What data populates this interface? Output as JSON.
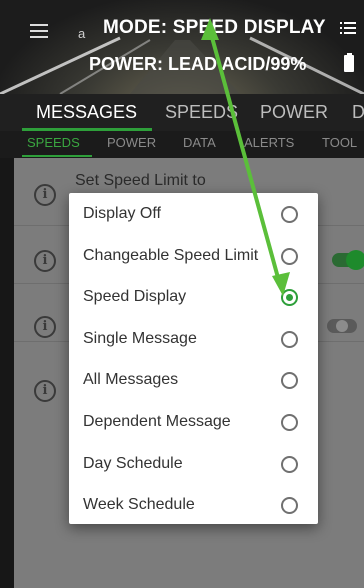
{
  "header": {
    "title": "MODE: SPEED DISPLAY",
    "small_label": "a",
    "power": "POWER: LEAD ACID/99%",
    "menu_icon": "hamburger-menu-icon",
    "list_icon": "list-icon",
    "battery_icon": "battery-icon"
  },
  "tabs": [
    {
      "label": "MESSAGES",
      "active": true
    },
    {
      "label": "SPEEDS",
      "active": false
    },
    {
      "label": "POWER",
      "active": false
    },
    {
      "label": "D",
      "active": false
    }
  ],
  "subtabs": [
    {
      "label": "SPEEDS",
      "active": true
    },
    {
      "label": "POWER",
      "active": false
    },
    {
      "label": "DATA",
      "active": false
    },
    {
      "label": "ALERTS",
      "active": false
    },
    {
      "label": "TOOL",
      "active": false
    }
  ],
  "content": {
    "rows": [
      {
        "text": "Set Speed Limit to"
      },
      {
        "text": ""
      },
      {
        "text": ""
      },
      {
        "text": ""
      }
    ]
  },
  "dialog": {
    "selected": "Speed Display",
    "options": [
      {
        "label": "Display Off",
        "checked": false
      },
      {
        "label": "Changeable Speed Limit",
        "checked": false
      },
      {
        "label": "Speed Display",
        "checked": true
      },
      {
        "label": "Single Message",
        "checked": false
      },
      {
        "label": "All Messages",
        "checked": false
      },
      {
        "label": "Dependent Message",
        "checked": false
      },
      {
        "label": "Day Schedule",
        "checked": false
      },
      {
        "label": "Week Schedule",
        "checked": false
      }
    ]
  },
  "colors": {
    "accent": "#2e9f3a",
    "annotation_arrow": "#5bbf3a"
  }
}
